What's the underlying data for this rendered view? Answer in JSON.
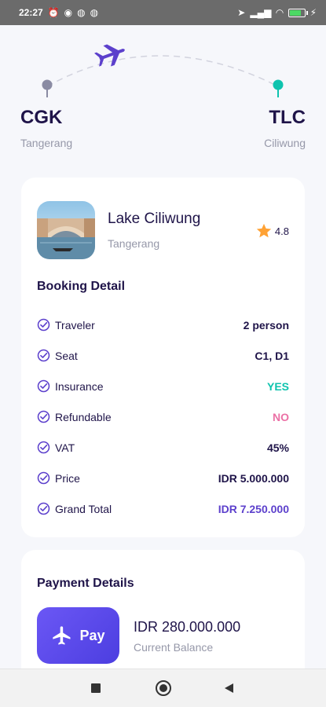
{
  "status_bar": {
    "time": "22:27",
    "battery_level": 0.7
  },
  "route": {
    "origin": {
      "code": "CGK",
      "city": "Tangerang"
    },
    "destination": {
      "code": "TLC",
      "city": "Ciliwung"
    }
  },
  "destination": {
    "name": "Lake Ciliwung",
    "city": "Tangerang",
    "rating": "4.8"
  },
  "booking": {
    "title": "Booking Detail",
    "items": [
      {
        "label": "Traveler",
        "value": "2 person",
        "color": "#1f1449"
      },
      {
        "label": "Seat",
        "value": "C1, D1",
        "color": "#1f1449"
      },
      {
        "label": "Insurance",
        "value": "YES",
        "color": "#0ec3ae"
      },
      {
        "label": "Refundable",
        "value": "NO",
        "color": "#eb70a5"
      },
      {
        "label": "VAT",
        "value": "45%",
        "color": "#1f1449"
      },
      {
        "label": "Price",
        "value": "IDR 5.000.000",
        "color": "#1f1449"
      },
      {
        "label": "Grand Total",
        "value": "IDR 7.250.000",
        "color": "#5c40cc"
      }
    ]
  },
  "payment": {
    "title": "Payment Details",
    "pay_label": "Pay",
    "balance": "IDR 280.000.000",
    "balance_label": "Current Balance"
  },
  "colors": {
    "primary": "#5c40cc",
    "success": "#0ec3ae",
    "danger": "#eb70a5",
    "text": "#1f1449",
    "muted": "#9698a9",
    "origin_dot": "#8a8ba3",
    "destination_dot": "#0ec3ae",
    "star": "#ffa235"
  },
  "icons": {
    "plane": "airplane-icon",
    "star": "star-icon",
    "check": "check-circle-icon"
  }
}
